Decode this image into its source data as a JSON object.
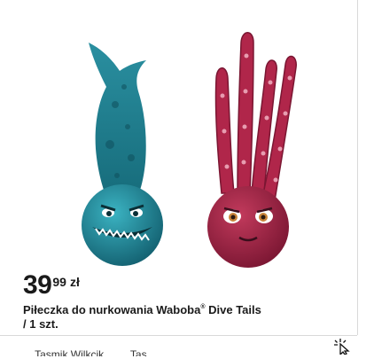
{
  "product": {
    "price_int": "39",
    "price_dec": "99",
    "currency": "zł",
    "title_main": "Piłeczka do nurkowania Waboba",
    "title_reg": "®",
    "title_rest": " Dive Tails",
    "unit": "/ 1 szt.",
    "image_icon": "shark-and-octopus-dive-balls-image"
  },
  "footer": {
    "cut_text": "... Tasmik Wilkcik ... ... Tas..."
  },
  "colors": {
    "shark_teal": "#1f8a99",
    "shark_dark": "#145f6e",
    "octopus_magenta": "#b0264a",
    "octopus_dark": "#7a1632",
    "divider": "#d9d9d9"
  },
  "icons": {
    "cursor": "click-cursor-icon"
  }
}
